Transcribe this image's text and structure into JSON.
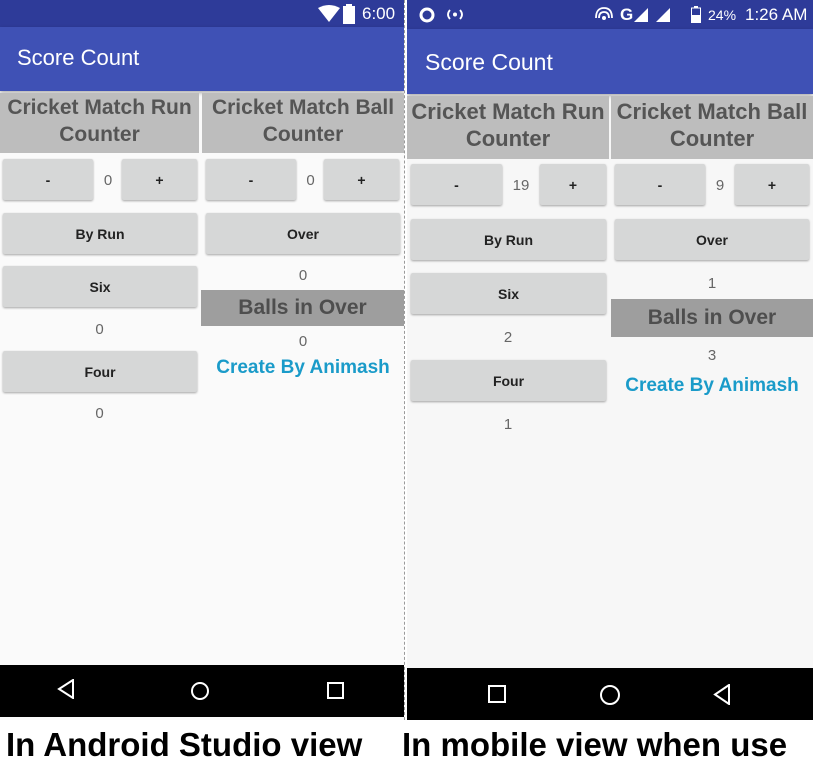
{
  "left": {
    "status": {
      "time": "6:00"
    },
    "app_title": "Score Count",
    "run_header": {
      "line1": "Cricket Match Run",
      "line2": "Counter"
    },
    "ball_header": {
      "line1": "Cricket Match Ball",
      "line2": "Counter"
    },
    "minus_label": "-",
    "plus_label": "+",
    "run_count": "0",
    "ball_count": "0",
    "by_run_label": "By Run",
    "six_label": "Six",
    "six_count": "0",
    "four_label": "Four",
    "four_count": "0",
    "over_label": "Over",
    "over_count": "0",
    "balls_in_over_label": "Balls in Over",
    "balls_in_over_count": "0",
    "credit": "Create By Animash"
  },
  "right": {
    "status": {
      "network": "G",
      "battery": "24%",
      "time": "1:26 AM"
    },
    "app_title": "Score Count",
    "run_header": {
      "line1": "Cricket Match Run",
      "line2": "Counter"
    },
    "ball_header": {
      "line1": "Cricket Match Ball",
      "line2": "Counter"
    },
    "minus_label": "-",
    "plus_label": "+",
    "run_count": "19",
    "ball_count": "9",
    "by_run_label": "By Run",
    "six_label": "Six",
    "six_count": "2",
    "four_label": "Four",
    "four_count": "1",
    "over_label": "Over",
    "over_count": "1",
    "balls_in_over_label": "Balls in Over",
    "balls_in_over_count": "3",
    "credit": "Create By Animash"
  },
  "captions": {
    "left": "In Android Studio view",
    "right": "In mobile view when use"
  },
  "colors": {
    "app_bar": "#3f51b5",
    "status_bar": "#2e3b99",
    "header_bg": "#bdbdbd",
    "balls_bg": "#9e9e9e",
    "button_bg": "#d6d7d7",
    "credit": "#1a9bc9"
  },
  "icons": [
    "wifi-icon",
    "battery-icon",
    "record-icon",
    "hotspot-icon",
    "signal-icon",
    "back-icon",
    "home-icon",
    "recents-icon"
  ]
}
